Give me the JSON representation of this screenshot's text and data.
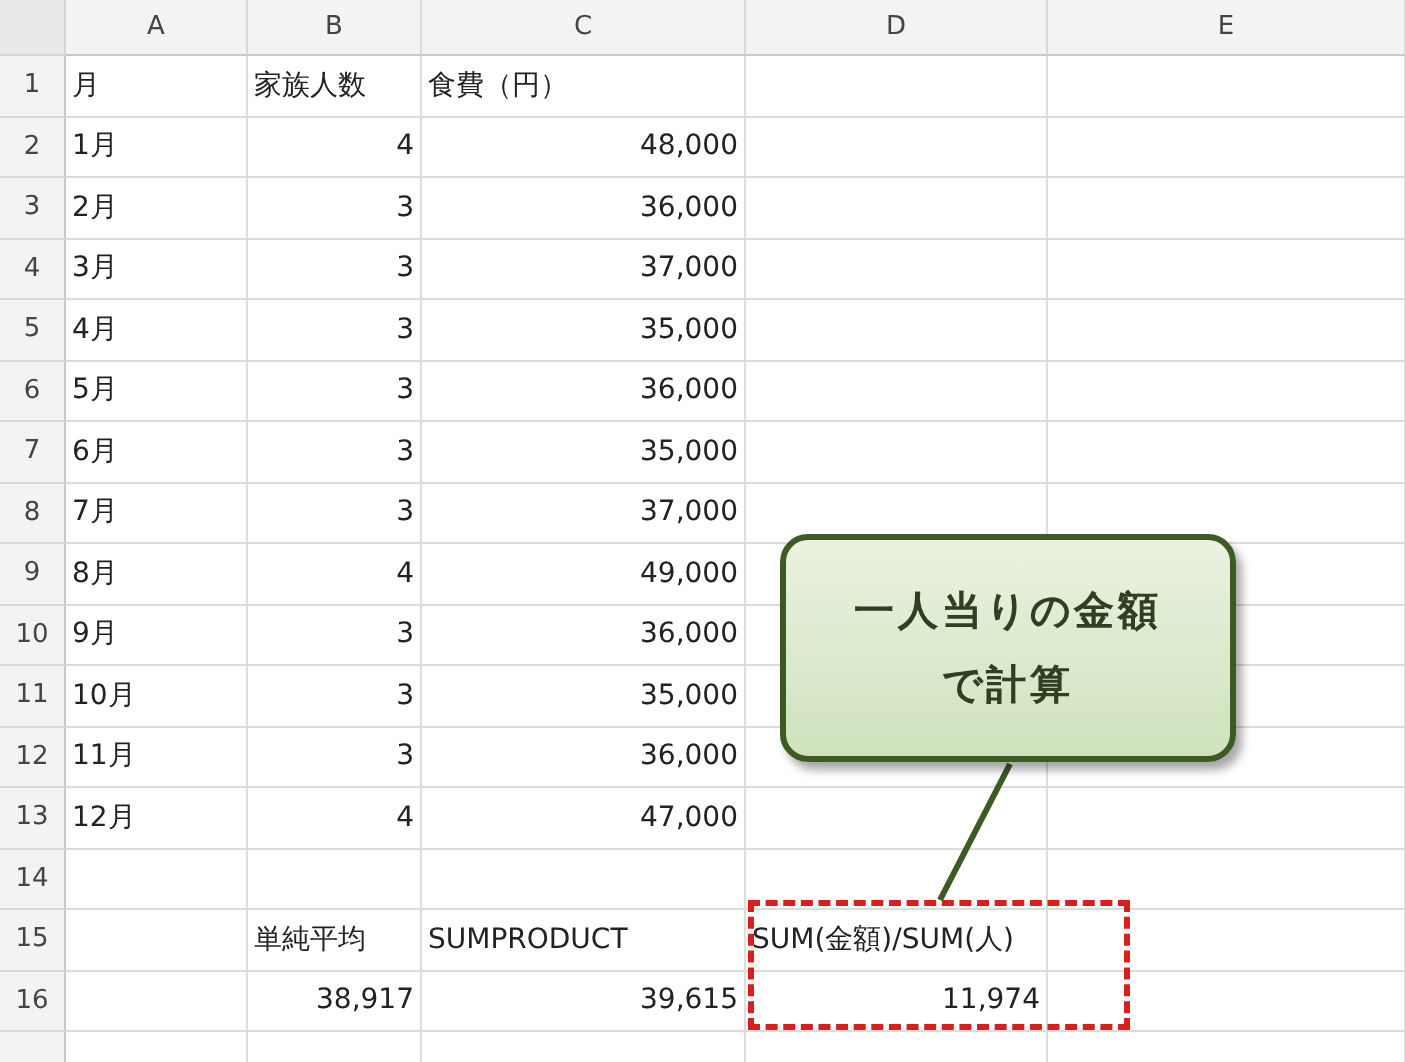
{
  "columns": [
    "A",
    "B",
    "C",
    "D",
    "E"
  ],
  "rows": [
    {
      "number": "1",
      "a": {
        "text": "月",
        "kind": "text"
      },
      "b": {
        "text": "家族人数",
        "kind": "text"
      },
      "c": {
        "text": "食費（円）",
        "kind": "text"
      }
    },
    {
      "number": "2",
      "a": {
        "text": "1月",
        "kind": "text"
      },
      "b": {
        "text": "4",
        "kind": "number"
      },
      "c": {
        "text": "48,000",
        "kind": "number"
      }
    },
    {
      "number": "3",
      "a": {
        "text": "2月",
        "kind": "text"
      },
      "b": {
        "text": "3",
        "kind": "number"
      },
      "c": {
        "text": "36,000",
        "kind": "number"
      }
    },
    {
      "number": "4",
      "a": {
        "text": "3月",
        "kind": "text"
      },
      "b": {
        "text": "3",
        "kind": "number"
      },
      "c": {
        "text": "37,000",
        "kind": "number"
      }
    },
    {
      "number": "5",
      "a": {
        "text": "4月",
        "kind": "text"
      },
      "b": {
        "text": "3",
        "kind": "number"
      },
      "c": {
        "text": "35,000",
        "kind": "number"
      }
    },
    {
      "number": "6",
      "a": {
        "text": "5月",
        "kind": "text"
      },
      "b": {
        "text": "3",
        "kind": "number"
      },
      "c": {
        "text": "36,000",
        "kind": "number"
      }
    },
    {
      "number": "7",
      "a": {
        "text": "6月",
        "kind": "text"
      },
      "b": {
        "text": "3",
        "kind": "number"
      },
      "c": {
        "text": "35,000",
        "kind": "number"
      }
    },
    {
      "number": "8",
      "a": {
        "text": "7月",
        "kind": "text"
      },
      "b": {
        "text": "3",
        "kind": "number"
      },
      "c": {
        "text": "37,000",
        "kind": "number"
      }
    },
    {
      "number": "9",
      "a": {
        "text": "8月",
        "kind": "text"
      },
      "b": {
        "text": "4",
        "kind": "number"
      },
      "c": {
        "text": "49,000",
        "kind": "number"
      }
    },
    {
      "number": "10",
      "a": {
        "text": "9月",
        "kind": "text"
      },
      "b": {
        "text": "3",
        "kind": "number"
      },
      "c": {
        "text": "36,000",
        "kind": "number"
      }
    },
    {
      "number": "11",
      "a": {
        "text": "10月",
        "kind": "text"
      },
      "b": {
        "text": "3",
        "kind": "number"
      },
      "c": {
        "text": "35,000",
        "kind": "number"
      }
    },
    {
      "number": "12",
      "a": {
        "text": "11月",
        "kind": "text"
      },
      "b": {
        "text": "3",
        "kind": "number"
      },
      "c": {
        "text": "36,000",
        "kind": "number"
      }
    },
    {
      "number": "13",
      "a": {
        "text": "12月",
        "kind": "text"
      },
      "b": {
        "text": "4",
        "kind": "number"
      },
      "c": {
        "text": "47,000",
        "kind": "number"
      }
    },
    {
      "number": "14"
    },
    {
      "number": "15",
      "b": {
        "text": "単純平均",
        "kind": "text"
      },
      "c": {
        "text": "SUMPRODUCT",
        "kind": "text"
      },
      "d": {
        "text": "SUM(金額)/SUM(人)",
        "kind": "text"
      }
    },
    {
      "number": "16",
      "b": {
        "text": "38,917",
        "kind": "number"
      },
      "c": {
        "text": "39,615",
        "kind": "number"
      },
      "d": {
        "text": "11,974",
        "kind": "number"
      }
    }
  ],
  "callout": {
    "lines": [
      "一人当りの金額",
      "で計算"
    ]
  }
}
